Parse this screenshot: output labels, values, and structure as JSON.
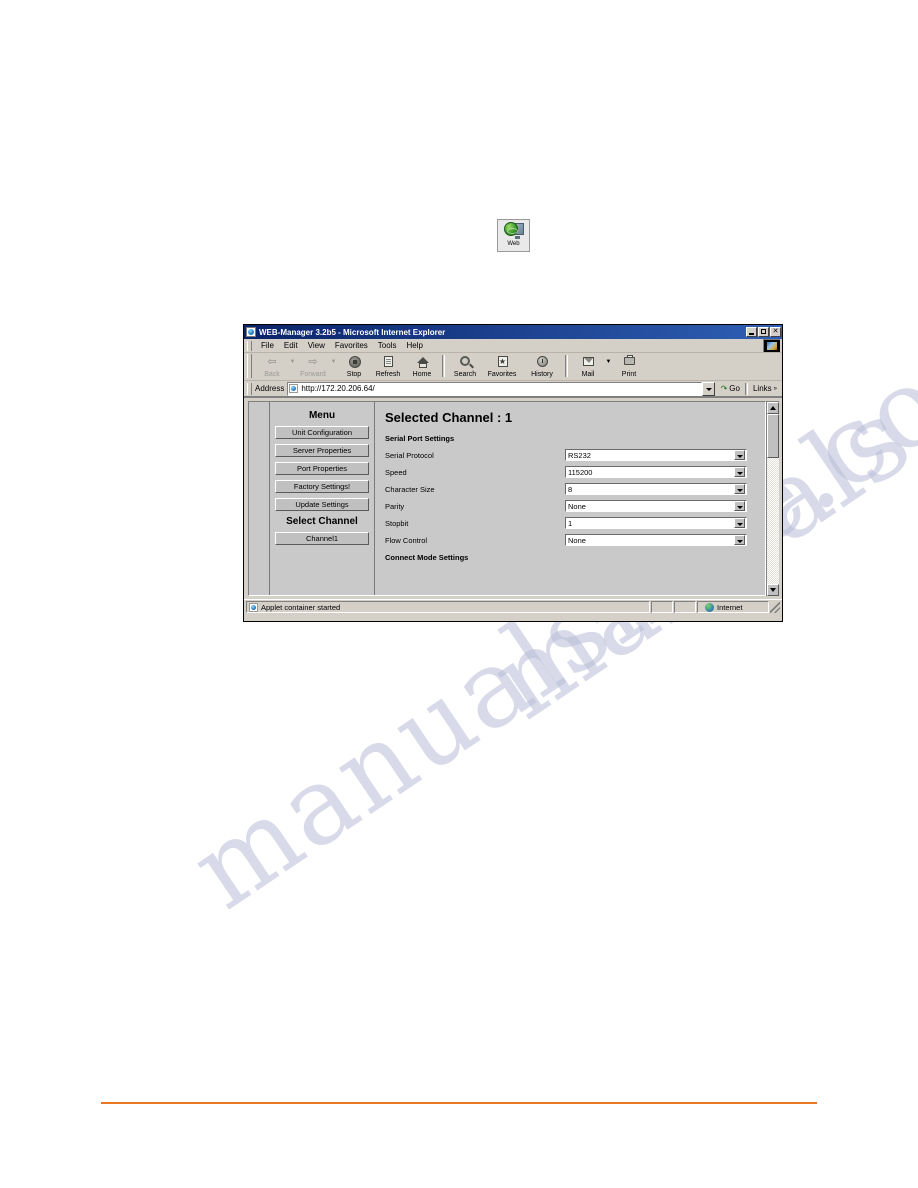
{
  "desktop_icon": {
    "label": "Web",
    "icon": "web-globe-monitor-icon"
  },
  "browser": {
    "title": "WEB-Manager 3.2b5 - Microsoft Internet Explorer",
    "title_icon": "ie-document-icon",
    "window_controls": {
      "minimize": "minimize-icon",
      "maximize": "maximize-icon",
      "close": "✕"
    },
    "menu_bar": {
      "items": [
        {
          "label": "File"
        },
        {
          "label": "Edit"
        },
        {
          "label": "View"
        },
        {
          "label": "Favorites"
        },
        {
          "label": "Tools"
        },
        {
          "label": "Help"
        }
      ],
      "logo": "ie-brand-logo"
    },
    "toolbar": {
      "buttons": [
        {
          "label": "Back",
          "icon": "back-arrow-icon",
          "disabled": true,
          "has_caret": true
        },
        {
          "label": "Forward",
          "icon": "forward-arrow-icon",
          "disabled": true,
          "has_caret": true
        },
        {
          "label": "Stop",
          "icon": "stop-icon",
          "disabled": false,
          "has_caret": false
        },
        {
          "label": "Refresh",
          "icon": "refresh-icon",
          "disabled": false,
          "has_caret": false
        },
        {
          "label": "Home",
          "icon": "home-icon",
          "disabled": false,
          "has_caret": false
        },
        {
          "label": "Search",
          "icon": "search-magnifier-icon",
          "disabled": false,
          "has_caret": false
        },
        {
          "label": "Favorites",
          "icon": "favorites-star-icon",
          "disabled": false,
          "has_caret": false
        },
        {
          "label": "History",
          "icon": "history-clock-icon",
          "disabled": false,
          "has_caret": false
        },
        {
          "label": "Mail",
          "icon": "mail-envelope-icon",
          "disabled": false,
          "has_caret": true
        },
        {
          "label": "Print",
          "icon": "printer-icon",
          "disabled": false,
          "has_caret": false
        }
      ]
    },
    "address_bar": {
      "label": "Address",
      "url": "http://172.20.206.64/",
      "placeholder": "http://",
      "go_label": "Go",
      "links_label": "Links",
      "links_chevrons": "»"
    },
    "status_bar": {
      "message": "Applet container started",
      "zone": "Internet"
    }
  },
  "page": {
    "menu": {
      "title": "Menu",
      "buttons": [
        {
          "label": "Unit Configuration"
        },
        {
          "label": "Server Properties"
        },
        {
          "label": "Port Properties"
        },
        {
          "label": "Factory Settings!"
        },
        {
          "label": "Update Settings"
        }
      ],
      "channel_title": "Select Channel",
      "channel_buttons": [
        {
          "label": "Channel1"
        }
      ]
    },
    "content": {
      "title": "Selected Channel : 1",
      "serial_section": "Serial Port Settings",
      "fields": [
        {
          "label": "Serial Protocol",
          "value": "RS232"
        },
        {
          "label": "Speed",
          "value": "115200"
        },
        {
          "label": "Character Size",
          "value": "8"
        },
        {
          "label": "Parity",
          "value": "None"
        },
        {
          "label": "Stopbit",
          "value": "1"
        },
        {
          "label": "Flow Control",
          "value": "None"
        }
      ],
      "connect_section": "Connect Mode Settings"
    }
  },
  "watermark": {
    "line1": "manualshive.com",
    "line2": "manuals"
  },
  "colors": {
    "title_bar": "#0a246a",
    "chrome": "#d4d0c8",
    "page_bg": "#c9c9c9",
    "rule": "#e87722"
  }
}
